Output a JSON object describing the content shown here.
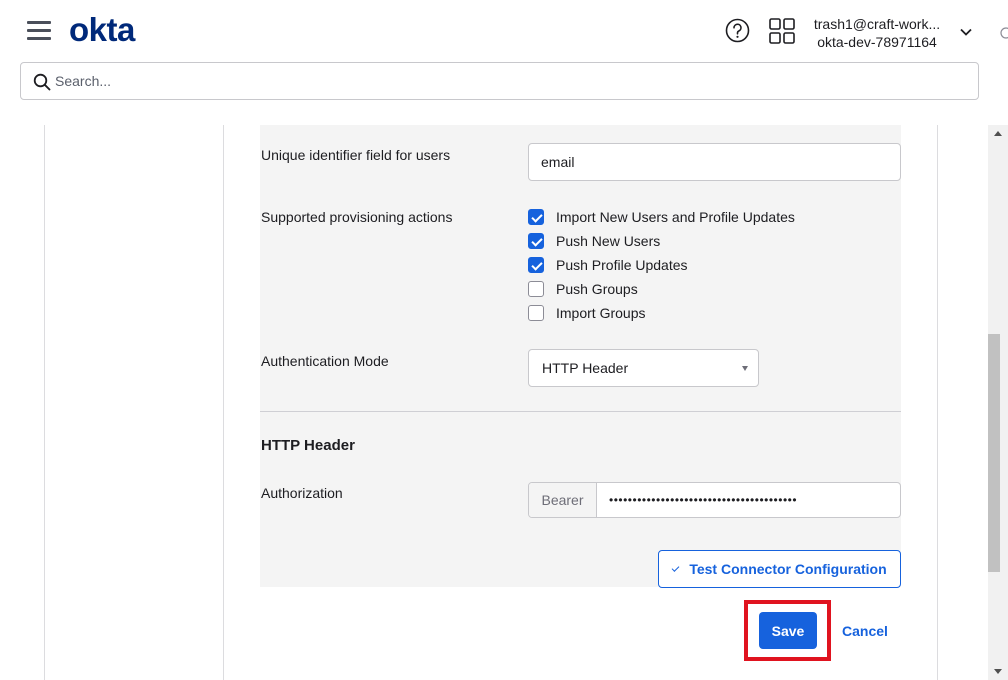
{
  "header": {
    "logo_text": "okta",
    "user_email": "trash1@craft-work...",
    "org_name": "okta-dev-78971164"
  },
  "search": {
    "placeholder": "Search..."
  },
  "form": {
    "unique_id_label": "Unique identifier field for users",
    "unique_id_value": "email",
    "provisioning_label": "Supported provisioning actions",
    "provisioning_actions": [
      {
        "label": "Import New Users and Profile Updates",
        "checked": true
      },
      {
        "label": "Push New Users",
        "checked": true
      },
      {
        "label": "Push Profile Updates",
        "checked": true
      },
      {
        "label": "Push Groups",
        "checked": false
      },
      {
        "label": "Import Groups",
        "checked": false
      }
    ],
    "auth_mode_label": "Authentication Mode",
    "auth_mode_value": "HTTP Header",
    "http_header_title": "HTTP Header",
    "authorization_label": "Authorization",
    "authorization_prefix": "Bearer",
    "authorization_value": "••••••••••••••••••••••••••••••••••••••••",
    "test_button_label": "Test Connector Configuration"
  },
  "actions": {
    "save_label": "Save",
    "cancel_label": "Cancel"
  },
  "colors": {
    "brand": "#00297a",
    "accent": "#1662dd",
    "highlight": "#e0131f",
    "panel_bg": "#f4f4f4"
  }
}
